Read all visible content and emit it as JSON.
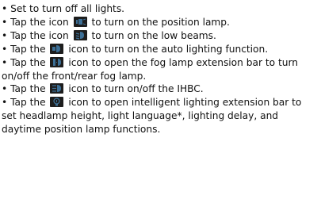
{
  "bullet_char": "•",
  "items": [
    {
      "pre": "Set to turn off all lights."
    },
    {
      "pre": "Tap the icon",
      "icon": "position-lamp-icon",
      "post": "to turn on the position lamp."
    },
    {
      "pre": "Tap the icon",
      "icon": "low-beam-icon",
      "post": "to turn on the low beams."
    },
    {
      "pre": "Tap the",
      "icon": "auto-lighting-icon",
      "post": "icon to turn on the auto lighting function."
    },
    {
      "pre": "Tap the",
      "icon": "fog-lamp-icon",
      "post": "icon to open the fog lamp extension bar to turn on/off the front/rear fog lamp."
    },
    {
      "pre": "Tap the",
      "icon": "ihbc-icon",
      "post": "icon to turn on/off the IHBC."
    },
    {
      "pre": "Tap the",
      "icon": "intelligent-lighting-icon",
      "post": "icon to open intelligent lighting extension bar to set headlamp height, light language*, lighting delay, and daytime position lamp functions."
    }
  ],
  "icon_colors": {
    "background": "#1d1d1d",
    "symbol": "#3c6f96"
  }
}
